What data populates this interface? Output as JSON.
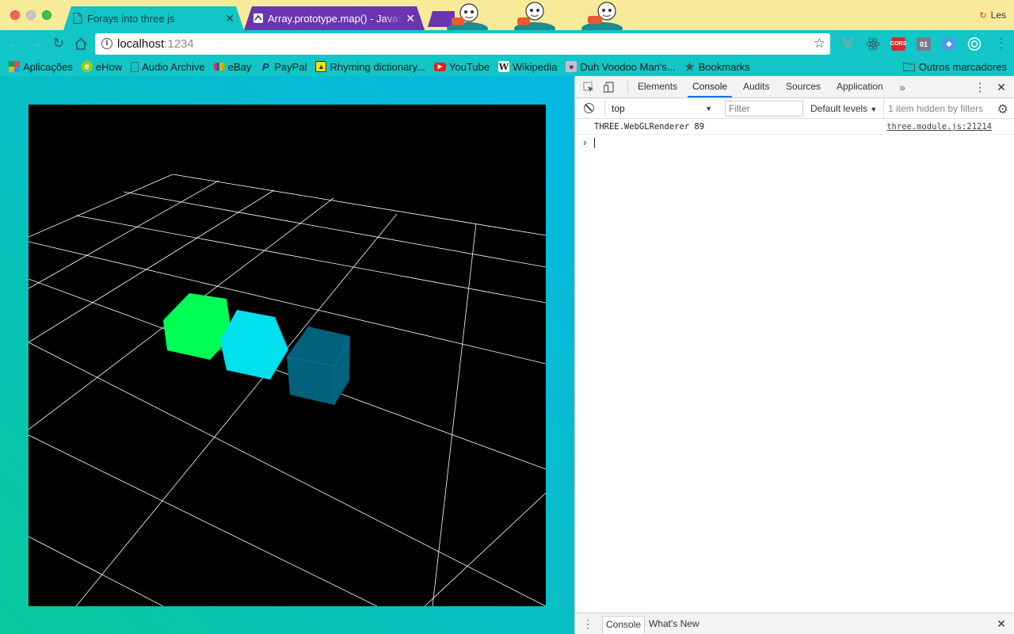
{
  "window": {
    "tabs": [
      {
        "title": "Forays into three js",
        "active": true
      },
      {
        "title": "Array.prototype.map() - JavaScript | MDN",
        "active": false
      }
    ],
    "profile_name": "Les"
  },
  "toolbar": {
    "url_host": "localhost",
    "url_port": ":1234"
  },
  "extensions": {
    "cors_label": "CORS",
    "counter_label": "01"
  },
  "bookmarks": {
    "items": [
      {
        "label": "Aplicações",
        "icon": "apps-grid-icon"
      },
      {
        "label": "eHow",
        "icon": "ehow-icon"
      },
      {
        "label": "Audio Archive",
        "icon": "page-icon"
      },
      {
        "label": "eBay",
        "icon": "ebay-icon"
      },
      {
        "label": "PayPal",
        "icon": "paypal-icon"
      },
      {
        "label": "Rhyming dictionary...",
        "icon": "rhyme-icon"
      },
      {
        "label": "YouTube",
        "icon": "youtube-icon"
      },
      {
        "label": "Wikipedia",
        "icon": "wikipedia-icon"
      },
      {
        "label": "Duh Voodoo Man's...",
        "icon": "voodoo-icon"
      },
      {
        "label": "Bookmarks",
        "icon": "star-icon"
      }
    ],
    "other": "Outros marcadores"
  },
  "scene": {
    "cubes": [
      {
        "name": "green-cube",
        "color": "#00ff55"
      },
      {
        "name": "cyan-cube",
        "color": "#00e0ee"
      },
      {
        "name": "teal-cube",
        "color": "#02617c"
      }
    ],
    "grid_color": "#ffffff",
    "background": "#000000"
  },
  "devtools": {
    "tabs": [
      "Elements",
      "Console",
      "Audits",
      "Sources",
      "Application"
    ],
    "active_tab": "Console",
    "context": "top",
    "filter_placeholder": "Filter",
    "levels": "Default levels",
    "hidden_count": "1 item hidden by filters",
    "logs": [
      {
        "message": "THREE.WebGLRenderer 89",
        "source": "three.module.js:21214"
      }
    ],
    "drawer_tabs": [
      "Console",
      "What's New"
    ]
  }
}
